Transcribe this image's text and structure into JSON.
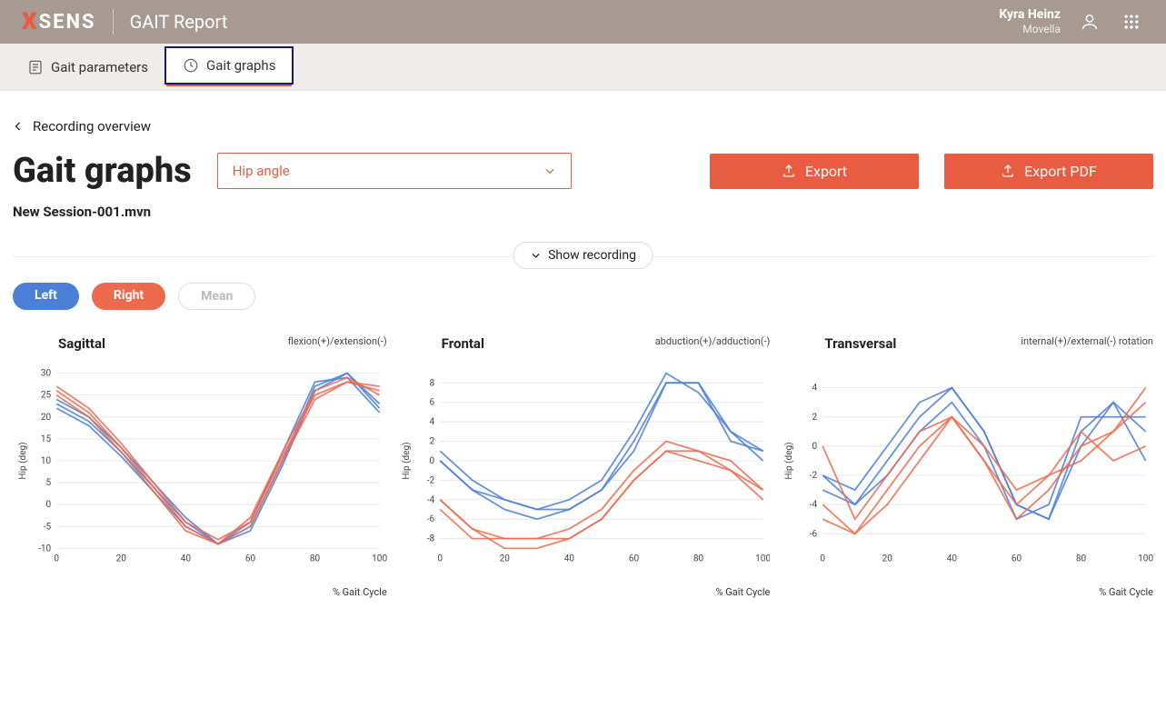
{
  "header": {
    "logo_prefix": "X",
    "logo_text": "SENS",
    "title": "GAIT Report",
    "user_name": "Kyra Heinz",
    "user_company": "Movella"
  },
  "tabs": {
    "parameters": "Gait parameters",
    "graphs": "Gait graphs"
  },
  "back_label": "Recording overview",
  "page_title": "Gait graphs",
  "select_value": "Hip angle",
  "buttons": {
    "export": "Export",
    "export_pdf": "Export PDF"
  },
  "session_label": "New Session-001.mvn",
  "show_recording": "Show recording",
  "pills": {
    "left": "Left",
    "right": "Right",
    "mean": "Mean"
  },
  "colors": {
    "left": "#4b7fd8",
    "right": "#ee6a4e",
    "accent": "#e85c41",
    "header_bg": "#a69a92"
  },
  "chart_common": {
    "xlabel": "% Gait Cycle",
    "ylabel": "Hip (deg)",
    "x": [
      0,
      10,
      20,
      30,
      40,
      50,
      60,
      70,
      80,
      90,
      100
    ],
    "xticks": [
      0,
      20,
      40,
      60,
      80,
      100
    ]
  },
  "chart_data": [
    {
      "title": "Sagittal",
      "subtitle": "flexion(+)/extension(-)",
      "type": "line",
      "ylim": [
        -10,
        30
      ],
      "yticks": [
        -10,
        -5,
        0,
        5,
        10,
        15,
        20,
        25,
        30
      ],
      "series": [
        {
          "name": "left-1",
          "color": "left",
          "values": [
            23,
            19,
            12,
            4,
            -4,
            -9,
            -5,
            10,
            27,
            30,
            22
          ]
        },
        {
          "name": "left-2",
          "color": "left",
          "values": [
            24,
            20,
            13,
            5,
            -3,
            -9,
            -6,
            9,
            26,
            30,
            23
          ]
        },
        {
          "name": "left-3",
          "color": "left",
          "values": [
            22,
            18,
            11,
            3,
            -5,
            -9,
            -4,
            12,
            28,
            29,
            21
          ]
        },
        {
          "name": "right-1",
          "color": "right",
          "values": [
            27,
            22,
            14,
            5,
            -4,
            -8,
            -4,
            11,
            25,
            28,
            26
          ]
        },
        {
          "name": "right-2",
          "color": "right",
          "values": [
            26,
            21,
            13,
            4,
            -5,
            -9,
            -5,
            10,
            24,
            28,
            27
          ]
        },
        {
          "name": "right-3",
          "color": "right",
          "values": [
            25,
            20,
            12,
            3,
            -6,
            -9,
            -3,
            12,
            26,
            29,
            25
          ]
        }
      ]
    },
    {
      "title": "Frontal",
      "subtitle": "abduction(+)/adduction(-)",
      "type": "line",
      "ylim": [
        -9,
        9
      ],
      "yticks": [
        -8,
        -6,
        -4,
        -2,
        0,
        2,
        4,
        6,
        8
      ],
      "series": [
        {
          "name": "left-1",
          "color": "left",
          "values": [
            0,
            -3,
            -4,
            -5,
            -5,
            -3,
            2,
            8,
            8,
            3,
            1
          ]
        },
        {
          "name": "left-2",
          "color": "left",
          "values": [
            1,
            -2,
            -4,
            -5,
            -4,
            -2,
            3,
            9,
            7,
            3,
            0
          ]
        },
        {
          "name": "left-3",
          "color": "left",
          "values": [
            0,
            -3,
            -5,
            -6,
            -5,
            -3,
            1,
            8,
            8,
            2,
            1
          ]
        },
        {
          "name": "right-1",
          "color": "right",
          "values": [
            -4,
            -7,
            -8,
            -8,
            -8,
            -6,
            -2,
            1,
            1,
            -1,
            -3
          ]
        },
        {
          "name": "right-2",
          "color": "right",
          "values": [
            -4,
            -7,
            -9,
            -9,
            -8,
            -6,
            -2,
            1,
            0,
            -1,
            -4
          ]
        },
        {
          "name": "right-3",
          "color": "right",
          "values": [
            -5,
            -8,
            -8,
            -8,
            -7,
            -5,
            -1,
            2,
            1,
            0,
            -3
          ]
        }
      ]
    },
    {
      "title": "Transversal",
      "subtitle": "internal(+)/external(-) rotation",
      "type": "line",
      "ylim": [
        -7,
        5
      ],
      "yticks": [
        -6,
        -4,
        -2,
        0,
        2,
        4
      ],
      "series": [
        {
          "name": "left-1",
          "color": "left",
          "values": [
            -2,
            -4,
            -1,
            2,
            4,
            1,
            -4,
            -5,
            1,
            3,
            1
          ]
        },
        {
          "name": "left-2",
          "color": "left",
          "values": [
            -3,
            -4,
            -2,
            1,
            3,
            0,
            -5,
            -4,
            2,
            2,
            2
          ]
        },
        {
          "name": "left-3",
          "color": "left",
          "values": [
            -2,
            -3,
            0,
            3,
            4,
            1,
            -4,
            -5,
            0,
            3,
            -1
          ]
        },
        {
          "name": "right-1",
          "color": "right",
          "values": [
            -4,
            -6,
            -3,
            0,
            2,
            -1,
            -5,
            -3,
            0,
            1,
            3
          ]
        },
        {
          "name": "right-2",
          "color": "right",
          "values": [
            -5,
            -6,
            -4,
            -1,
            2,
            -1,
            -4,
            -2,
            -1,
            1,
            4
          ]
        },
        {
          "name": "right-3",
          "color": "right",
          "values": [
            0,
            -5,
            -2,
            1,
            2,
            0,
            -3,
            -2,
            1,
            -1,
            0
          ]
        }
      ]
    }
  ]
}
